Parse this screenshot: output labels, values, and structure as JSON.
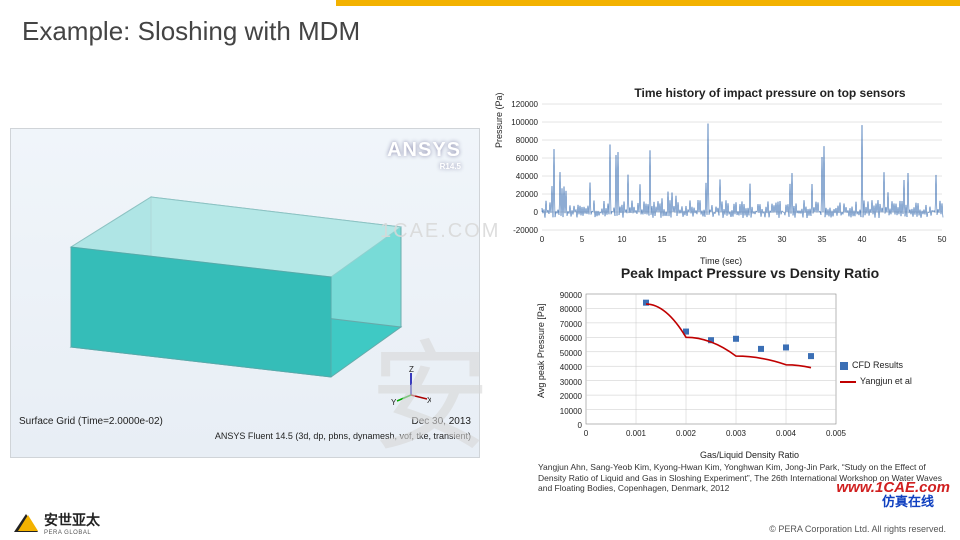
{
  "title": "Example: Sloshing with MDM",
  "render": {
    "software_label": "ANSYS",
    "software_sub": "R14.5",
    "surface_grid": "Surface Grid (Time=2.0000e-02)",
    "date": "Dec 30, 2013",
    "solver": "ANSYS Fluent 14.5 (3d, dp, pbns, dynamesh, vof, tke, transient)"
  },
  "chart_data": [
    {
      "type": "line",
      "title": "Time history of impact pressure on top sensors",
      "xlabel": "Time (sec)",
      "ylabel": "Pressure (Pa)",
      "xlim": [
        0,
        50
      ],
      "ylim": [
        -20000,
        120000
      ],
      "x_ticks": [
        0,
        5,
        10,
        15,
        20,
        25,
        30,
        35,
        40,
        45,
        50
      ],
      "y_ticks": [
        -20000,
        0,
        20000,
        40000,
        60000,
        80000,
        100000,
        120000
      ],
      "note": "dense multi-sensor impact spikes; values fluctuate roughly 0–100000 Pa with baseline near 0"
    },
    {
      "type": "scatter",
      "title": "Peak Impact Pressure vs Density Ratio",
      "xlabel": "Gas/Liquid Density Ratio",
      "ylabel": "Avg peak Pressure [Pa]",
      "xlim": [
        0,
        0.005
      ],
      "ylim": [
        0,
        90000
      ],
      "x_ticks": [
        0,
        0.001,
        0.002,
        0.003,
        0.004,
        0.005
      ],
      "y_ticks": [
        0,
        10000,
        20000,
        30000,
        40000,
        50000,
        60000,
        70000,
        80000,
        90000
      ],
      "series": [
        {
          "name": "CFD Results",
          "style": "points",
          "points": [
            {
              "x": 0.0012,
              "y": 84000
            },
            {
              "x": 0.002,
              "y": 64000
            },
            {
              "x": 0.0025,
              "y": 58000
            },
            {
              "x": 0.003,
              "y": 59000
            },
            {
              "x": 0.0035,
              "y": 52000
            },
            {
              "x": 0.004,
              "y": 53000
            },
            {
              "x": 0.0045,
              "y": 47000
            }
          ]
        },
        {
          "name": "Yangjun et al",
          "style": "curve",
          "points": [
            {
              "x": 0.0012,
              "y": 83000
            },
            {
              "x": 0.002,
              "y": 60000
            },
            {
              "x": 0.003,
              "y": 47000
            },
            {
              "x": 0.004,
              "y": 41000
            },
            {
              "x": 0.0045,
              "y": 39000
            }
          ]
        }
      ],
      "legend": [
        "CFD Results",
        "Yangjun et al"
      ]
    }
  ],
  "citation": "Yangjun Ahn, Sang-Yeob Kim, Kyong-Hwan Kim, Yonghwan Kim, Jong-Jin Park, “Study on the Effect of Density Ratio of Liquid and Gas in Sloshing Experiment”, The 26th International Workshop on Water Waves and Floating Bodies, Copenhagen, Denmark, 2012",
  "footer": {
    "company_cn": "安世亚太",
    "company_en": "PERA GLOBAL",
    "copyright": "©  PERA Corporation Ltd. All rights reserved."
  },
  "watermarks": {
    "big": "安",
    "cae": "1CAE.COM",
    "url": "www.1CAE.com",
    "cn": "仿真在线"
  }
}
